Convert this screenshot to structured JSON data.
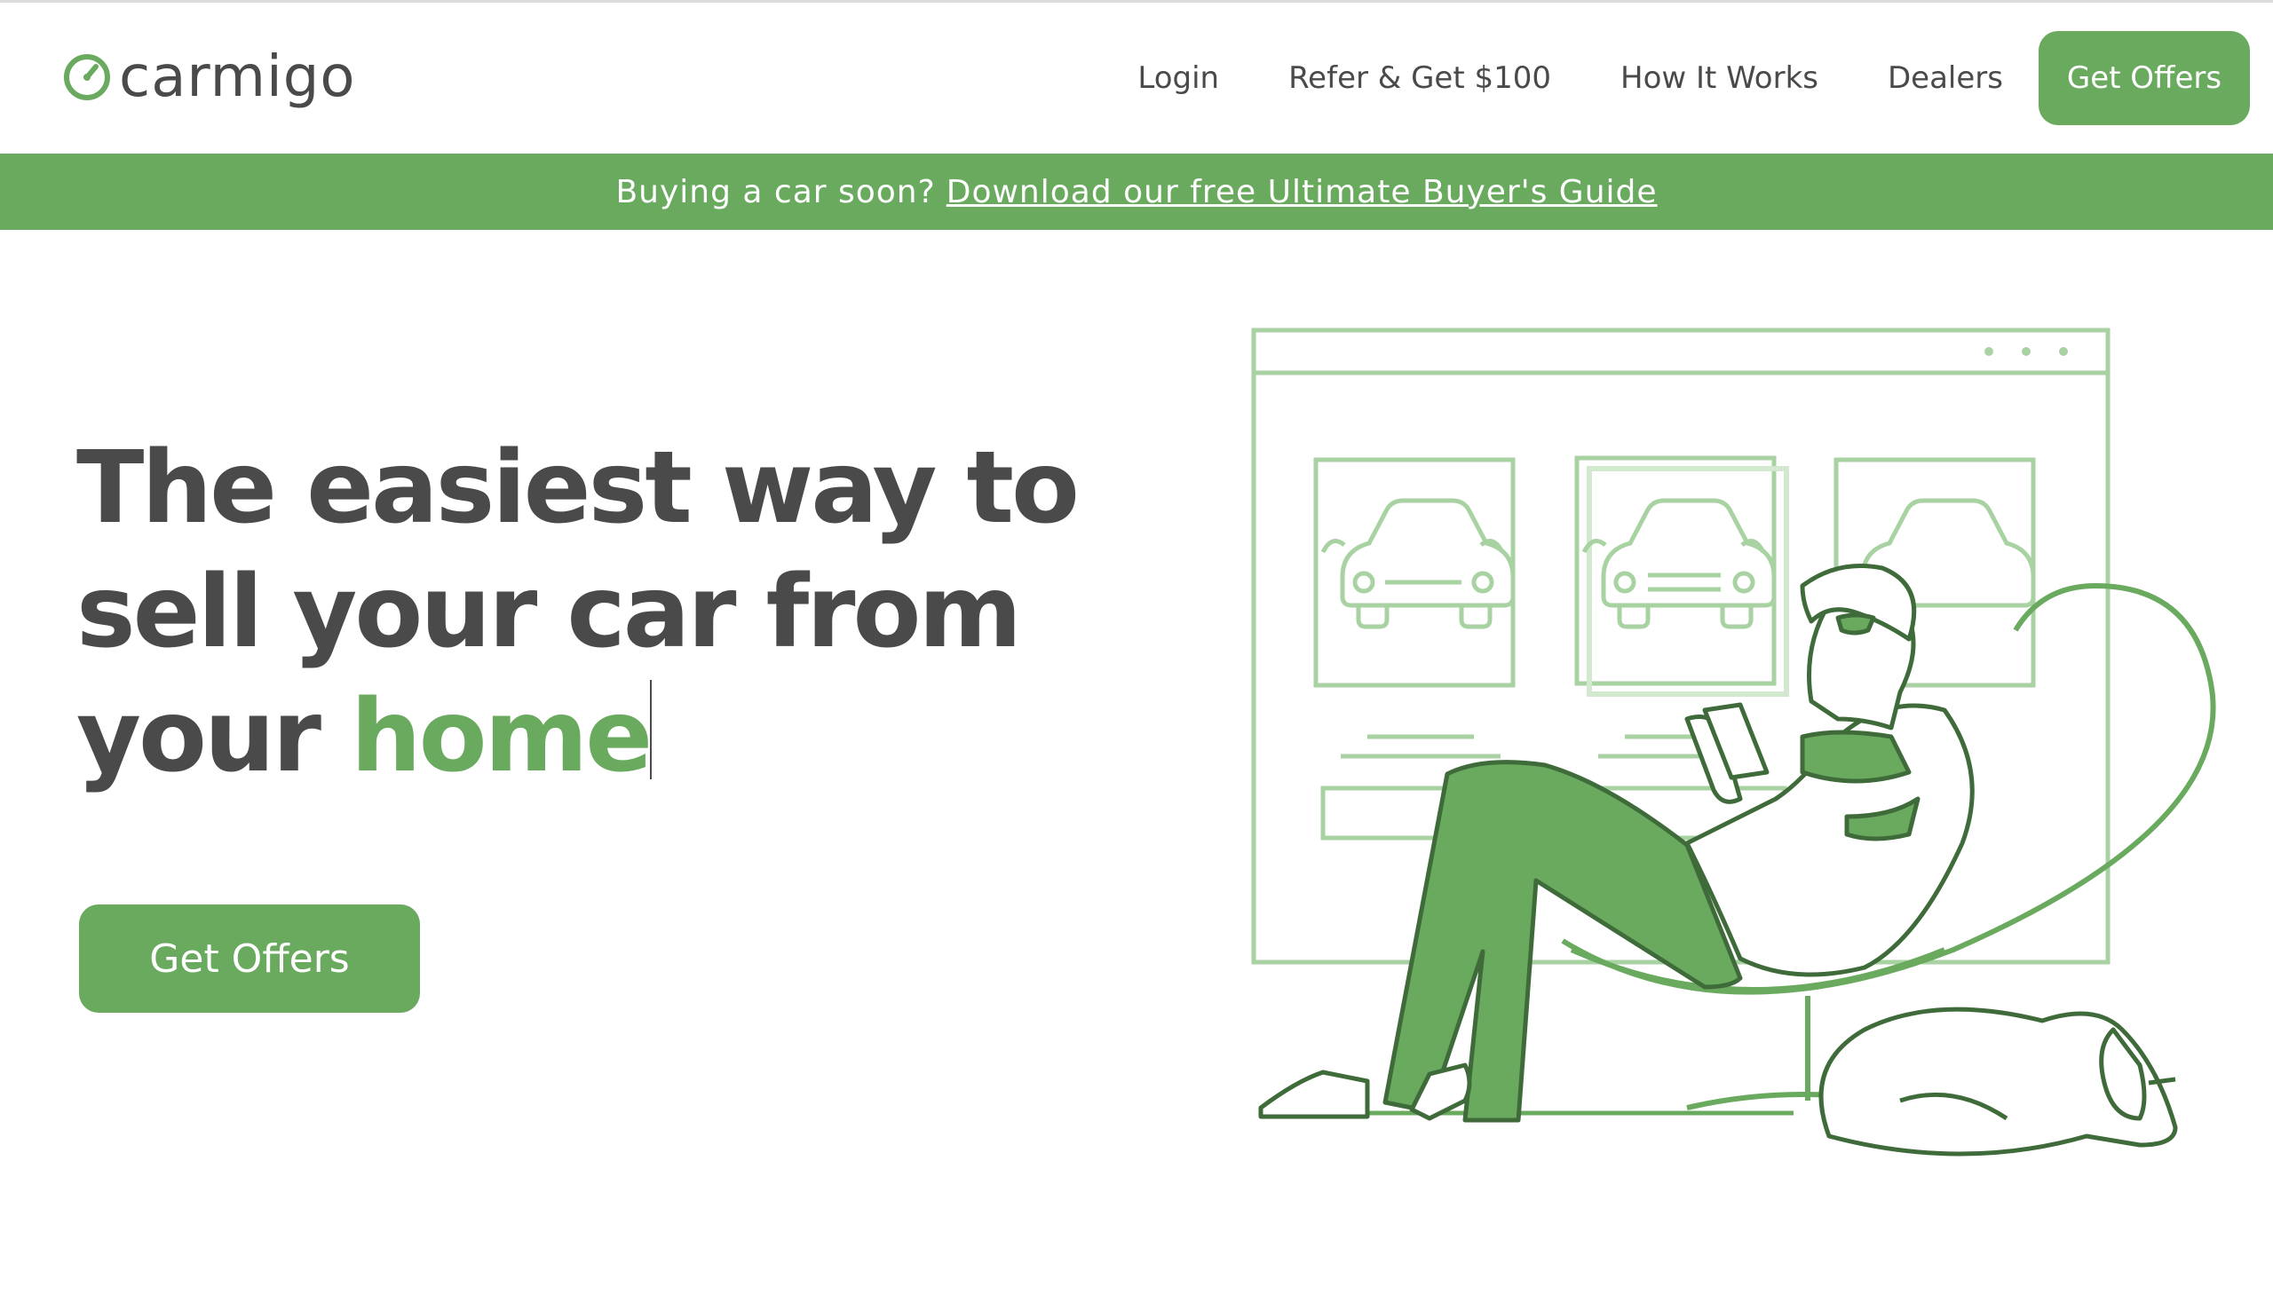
{
  "brand": {
    "name": "carmigo",
    "logo_icon": "speedometer-icon",
    "accent": "#6aaa5f",
    "text_color": "#4a4a4a"
  },
  "nav": {
    "links": [
      "Login",
      "Refer & Get $100",
      "How It Works",
      "Dealers"
    ],
    "cta": "Get Offers"
  },
  "banner": {
    "text": "Buying a car soon?",
    "link": "Download our free Ultimate Buyer's Guide"
  },
  "hero": {
    "title_line1": "The easiest way to",
    "title_line2": "sell your car from",
    "title_line3_plain": "your",
    "title_line3_accent": "home",
    "cta": "Get Offers"
  },
  "illustration": {
    "name": "person-relaxing-with-phone-and-dog"
  }
}
